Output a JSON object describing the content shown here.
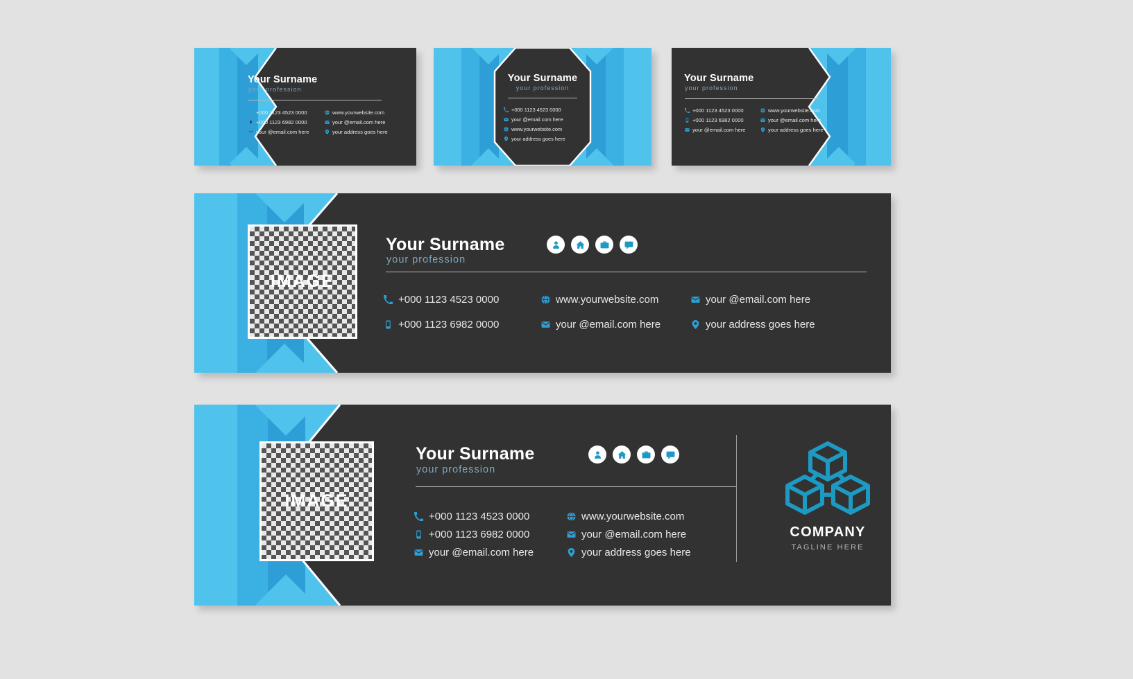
{
  "theme": {
    "background": "#e2e2e2",
    "panel_dark": "#323232",
    "blue_light": "#4FC3EC",
    "blue_mid": "#3BB0E3",
    "blue_deep": "#2E9FD6",
    "accent_icon": "#1C9AC4",
    "text_white": "#ffffff",
    "text_profession": "#7FA8BE",
    "text_body": "#e8e8e8"
  },
  "identity": {
    "name": "Your Surname",
    "profession": "your profession",
    "image_placeholder_label": "IMAGE"
  },
  "contacts": {
    "phone": "+000 1123 4523 0000",
    "mobile": "+000 1123 6982 0000",
    "email": "your @email.com here",
    "website": "www.yourwebsite.com",
    "address": "your address goes here"
  },
  "social_icons": [
    {
      "name": "person-icon",
      "label": "profile"
    },
    {
      "name": "home-icon",
      "label": "home"
    },
    {
      "name": "briefcase-icon",
      "label": "work"
    },
    {
      "name": "chat-icon",
      "label": "message"
    }
  ],
  "company": {
    "logo_icon": "blockchain-cubes-icon",
    "name": "COMPANY",
    "tagline": "TAGLINE HERE"
  },
  "cards": [
    {
      "id": "business-card-front-left-stripe",
      "layout": "left-stripe",
      "name": "Your Surname",
      "profession": "your profession",
      "contacts_col1": [
        {
          "icon": "phone-icon",
          "text": "+000 1123 4523 0000"
        },
        {
          "icon": "mobile-icon",
          "text": "+000 1123 6982 0000"
        },
        {
          "icon": "email-icon",
          "text": "your @email.com here"
        }
      ],
      "contacts_col2": [
        {
          "icon": "globe-icon",
          "text": "www.yourwebsite.com"
        },
        {
          "icon": "email-icon",
          "text": "your @email.com here"
        },
        {
          "icon": "location-icon",
          "text": "your address goes here"
        }
      ]
    },
    {
      "id": "business-card-centered-octagon",
      "layout": "centered-octagon",
      "name": "Your Surname",
      "profession": "your profession",
      "contacts_col1": [
        {
          "icon": "phone-icon",
          "text": "+000 1123 4523 0000"
        },
        {
          "icon": "email-icon",
          "text": "your @email.com here"
        },
        {
          "icon": "globe-icon",
          "text": "www.yourwebsite.com"
        },
        {
          "icon": "location-icon",
          "text": "your address goes here"
        }
      ],
      "contacts_col2": []
    },
    {
      "id": "business-card-right-stripe",
      "layout": "right-stripe",
      "name": "Your Surname",
      "profession": "your profession",
      "contacts_col1": [
        {
          "icon": "phone-icon",
          "text": "+000 1123 4523 0000"
        },
        {
          "icon": "mobile-icon",
          "text": "+000 1123 6982 0000"
        },
        {
          "icon": "email-icon",
          "text": "your @email.com here"
        }
      ],
      "contacts_col2": [
        {
          "icon": "globe-icon",
          "text": "www.yourwebsite.com"
        },
        {
          "icon": "email-icon",
          "text": "your @email.com here"
        },
        {
          "icon": "location-icon",
          "text": "your address goes here"
        }
      ]
    }
  ],
  "banner_top": {
    "id": "email-signature-banner",
    "name": "Your Surname",
    "profession": "your profession",
    "image_label": "IMAGE",
    "contacts_col1": [
      {
        "icon": "phone-icon",
        "text": "+000 1123 4523 0000"
      },
      {
        "icon": "mobile-icon",
        "text": "+000 1123 6982 0000"
      }
    ],
    "contacts_col2": [
      {
        "icon": "globe-icon",
        "text": "www.yourwebsite.com"
      },
      {
        "icon": "email-icon",
        "text": "your @email.com here"
      }
    ],
    "contacts_col3": [
      {
        "icon": "email-icon",
        "text": "your @email.com here"
      },
      {
        "icon": "location-icon",
        "text": "your address goes here"
      }
    ]
  },
  "banner_bottom": {
    "id": "email-signature-banner-with-logo",
    "name": "Your Surname",
    "profession": "your profession",
    "image_label": "IMAGE",
    "contacts_col1": [
      {
        "icon": "phone-icon",
        "text": "+000 1123 4523 0000"
      },
      {
        "icon": "mobile-icon",
        "text": "+000 1123 6982 0000"
      },
      {
        "icon": "email-icon",
        "text": "your @email.com here"
      }
    ],
    "contacts_col2": [
      {
        "icon": "globe-icon",
        "text": "www.yourwebsite.com"
      },
      {
        "icon": "email-icon",
        "text": "your @email.com here"
      },
      {
        "icon": "location-icon",
        "text": "your address goes here"
      }
    ],
    "company_name": "COMPANY",
    "company_tagline": "TAGLINE HERE"
  }
}
